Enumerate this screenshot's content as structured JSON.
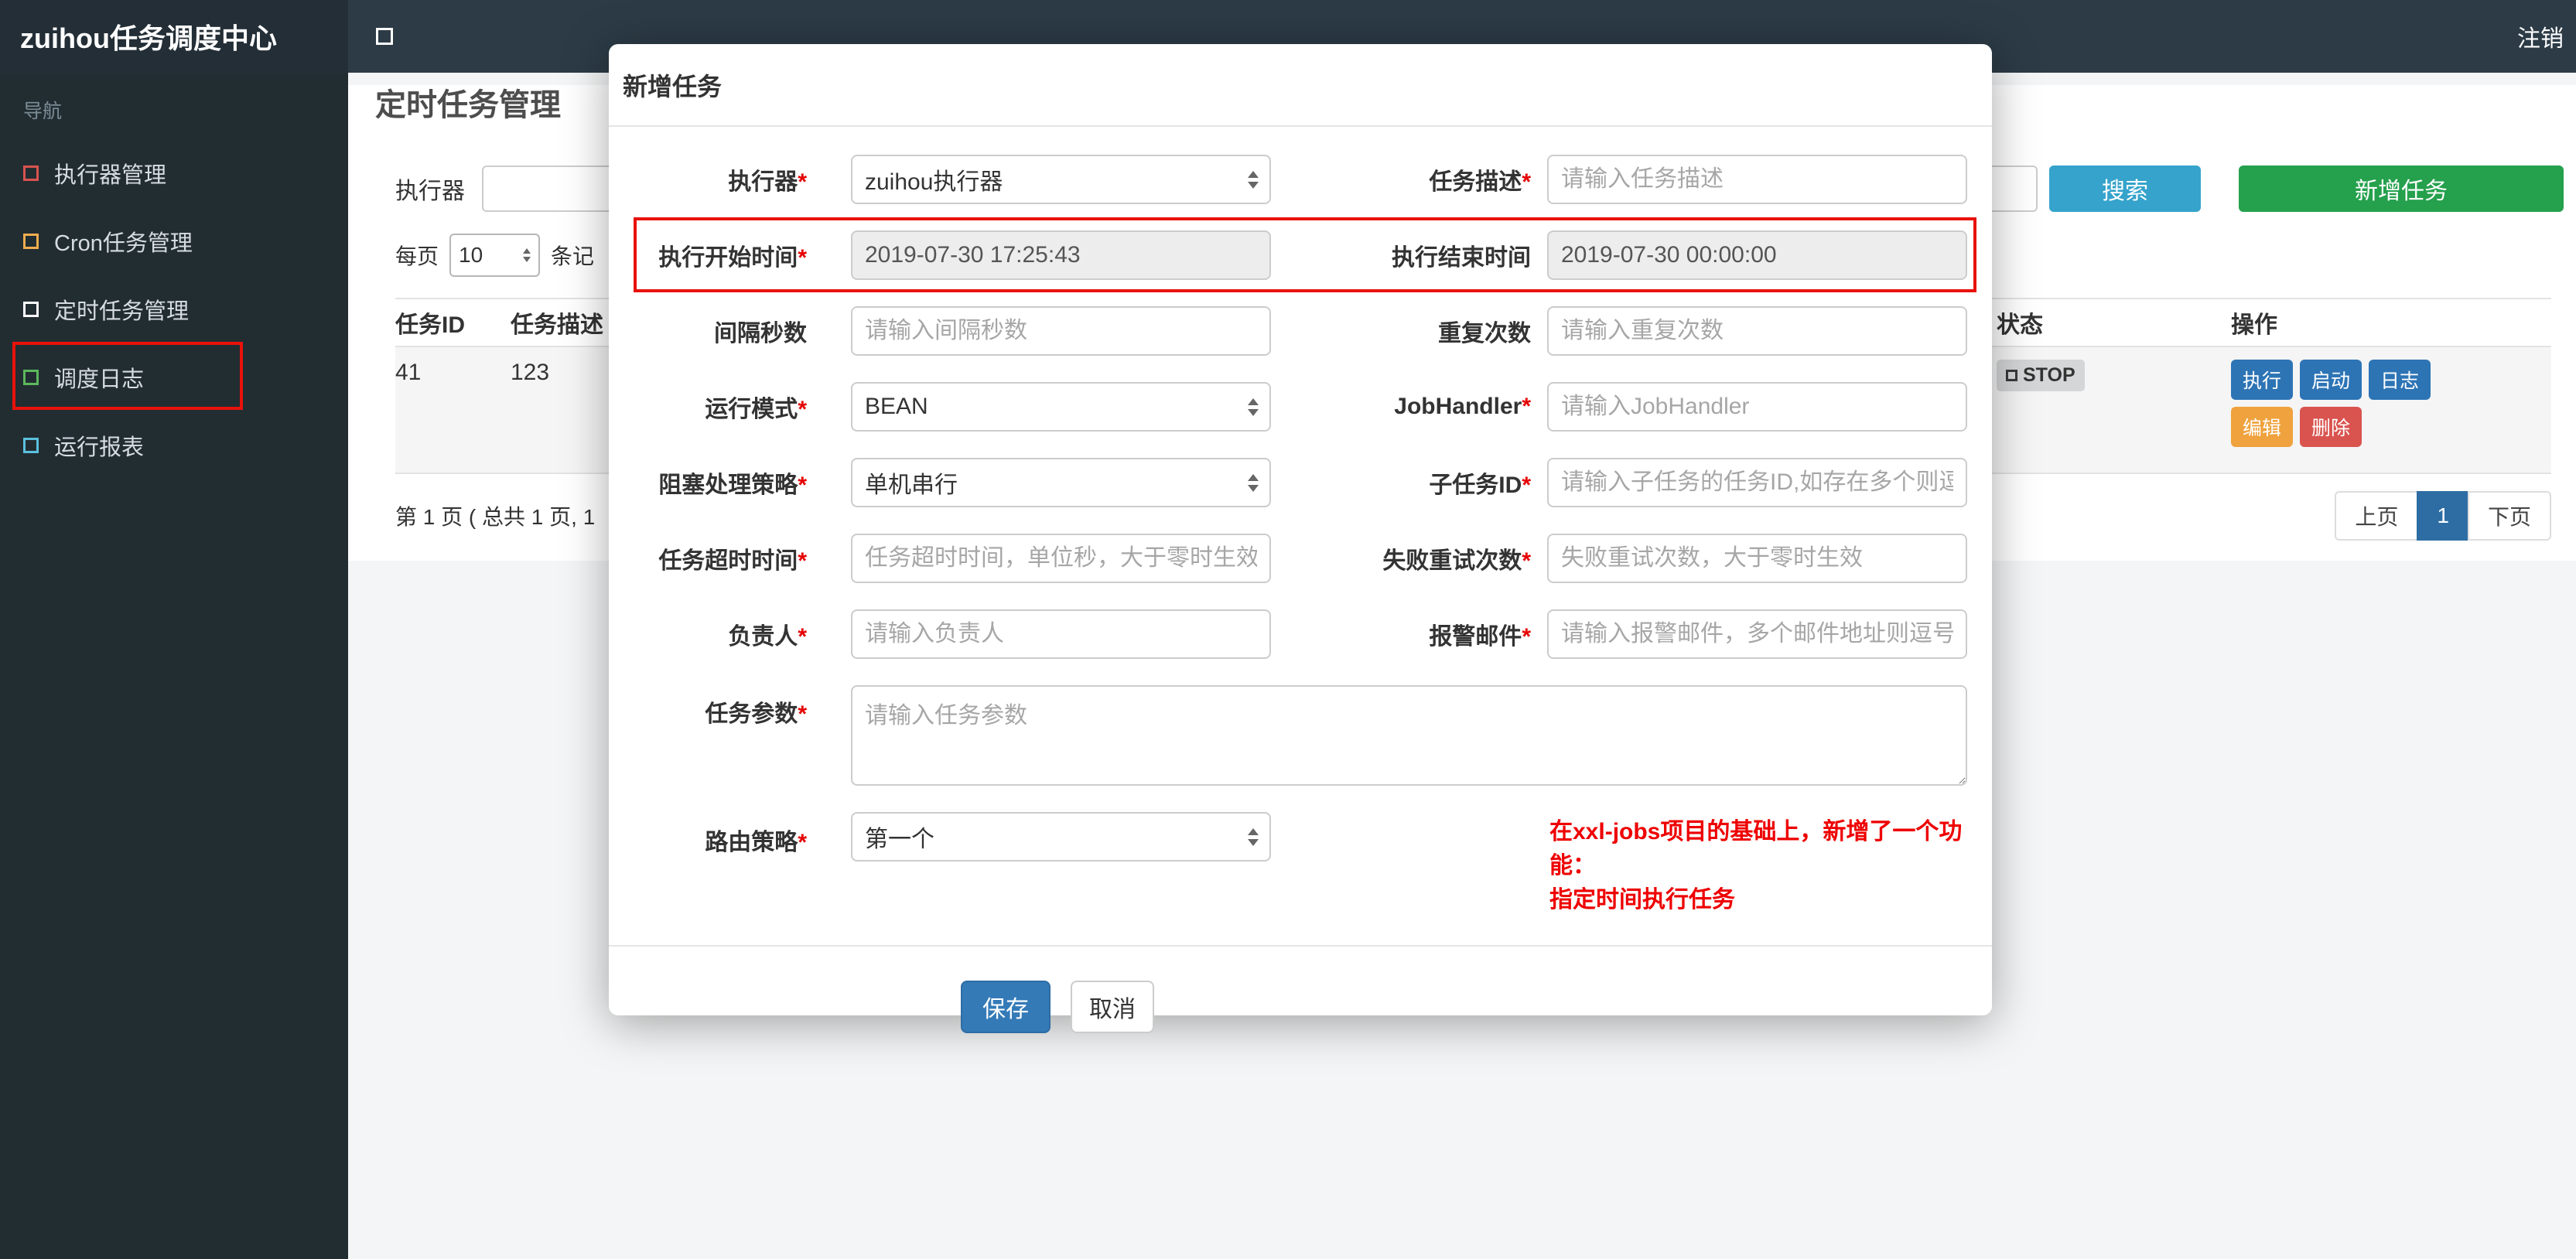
{
  "navbar": {
    "brand": "zuihou任务调度中心",
    "logout": "注销"
  },
  "sidebar": {
    "section_label": "导航",
    "items": [
      {
        "label": "执行器管理",
        "icon_color": "#d9534f"
      },
      {
        "label": "Cron任务管理",
        "icon_color": "#f0ad4e"
      },
      {
        "label": "定时任务管理",
        "icon_color": "#ffffff",
        "active": true
      },
      {
        "label": "调度日志",
        "icon_color": "#5cb85c"
      },
      {
        "label": "运行报表",
        "icon_color": "#5bc0de"
      }
    ]
  },
  "page": {
    "title": "定时任务管理"
  },
  "toolbar": {
    "executor_label": "执行器",
    "search_button": "搜索",
    "add_button": "新增任务"
  },
  "perpage": {
    "prefix": "每页",
    "value": "10",
    "suffix": "条记"
  },
  "table": {
    "headers": [
      "任务ID",
      "任务描述",
      "状态",
      "操作"
    ],
    "row": {
      "task_id": "41",
      "task_desc": "123",
      "status": "STOP",
      "btn_execute": "执行",
      "btn_start": "启动",
      "btn_log": "日志",
      "btn_edit": "编辑",
      "btn_delete": "删除"
    }
  },
  "pagination": {
    "summary": "第 1 页 ( 总共 1 页, 1",
    "prev": "上页",
    "page1": "1",
    "next": "下页"
  },
  "modal": {
    "title": "新增任务",
    "fields": [
      {
        "label": "执行器",
        "star": "*",
        "value": "zuihou执行器"
      },
      {
        "label": "任务描述",
        "star": "*",
        "placeholder": "请输入任务描述"
      },
      {
        "label": "执行开始时间",
        "star": "*",
        "value": "2019-07-30 17:25:43"
      },
      {
        "label": "执行结束时间",
        "value": "2019-07-30 00:00:00"
      },
      {
        "label": "间隔秒数",
        "placeholder": "请输入间隔秒数"
      },
      {
        "label": "重复次数",
        "placeholder": "请输入重复次数"
      },
      {
        "label": "运行模式",
        "star": "*",
        "value": "BEAN"
      },
      {
        "label": "JobHandler",
        "star": "*",
        "placeholder": "请输入JobHandler"
      },
      {
        "label": "阻塞处理策略",
        "star": "*",
        "value": "单机串行"
      },
      {
        "label": "子任务ID",
        "star": "*",
        "placeholder": "请输入子任务的任务ID,如存在多个则逗"
      },
      {
        "label": "任务超时时间",
        "star": "*",
        "placeholder": "任务超时时间，单位秒，大于零时生效"
      },
      {
        "label": "失败重试次数",
        "star": "*",
        "placeholder": "失败重试次数，大于零时生效"
      },
      {
        "label": "负责人",
        "star": "*",
        "placeholder": "请输入负责人"
      },
      {
        "label": "报警邮件",
        "star": "*",
        "placeholder": "请输入报警邮件，多个邮件地址则逗号分"
      },
      {
        "label": "任务参数",
        "star": "*",
        "placeholder": "请输入任务参数"
      },
      {
        "label": "路由策略",
        "star": "*",
        "value": "第一个"
      }
    ],
    "note_line1": "在xxl-jobs项目的基础上，新增了一个功能：",
    "note_line2": "指定时间执行任务",
    "save_button": "保存",
    "cancel_button": "取消"
  },
  "colors": {
    "navbar_bg": "#2c3b46",
    "sidebar_bg": "#222d32",
    "brand_bg": "#232e36",
    "search_button": "#35a3cb",
    "add_button": "#25a04d",
    "save_button": "#337ab7",
    "action_blue": "#2d74b5",
    "action_orange": "#efa23d",
    "action_red": "#d9534f",
    "active_page": "#2e6da4",
    "annotation_red": "#e8120b",
    "note_red": "#ee0000",
    "status_badge_bg": "#d4d6d7"
  }
}
